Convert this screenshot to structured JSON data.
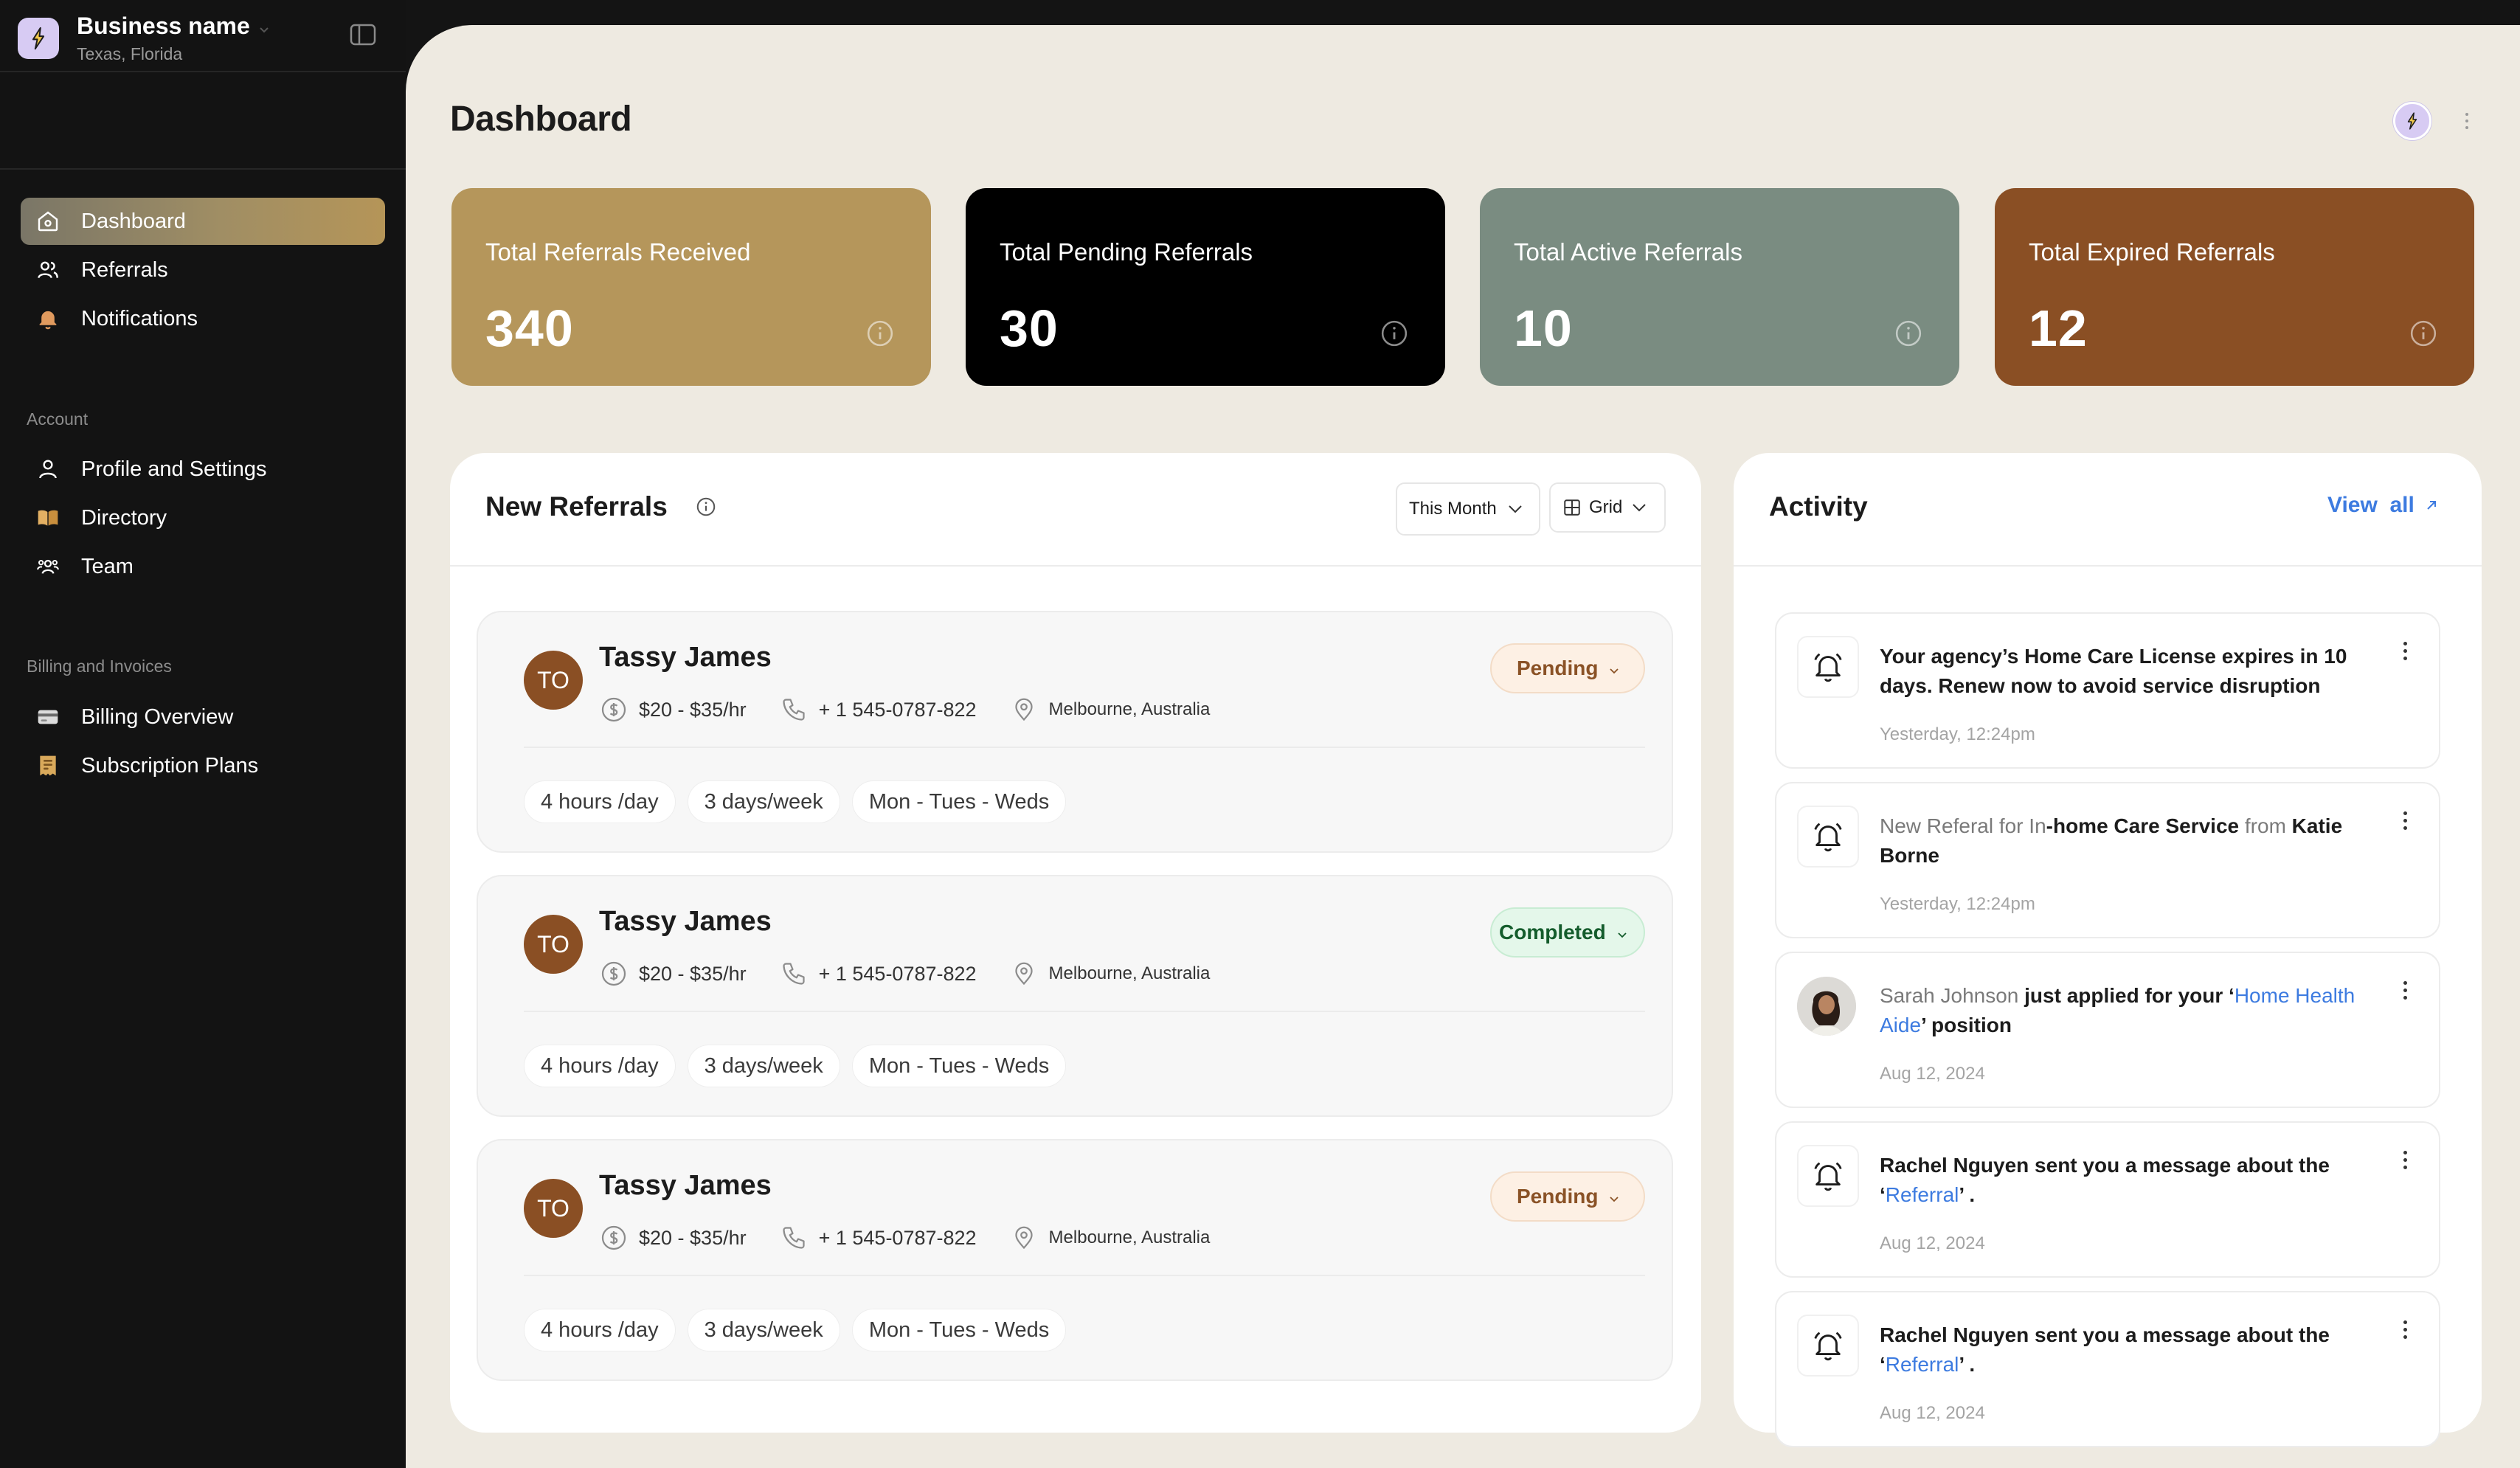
{
  "business": {
    "name": "Business name",
    "location": "Texas, Florida"
  },
  "sidebar": {
    "main_items": [
      {
        "label": "Dashboard",
        "icon": "home-icon",
        "active": true
      },
      {
        "label": "Referrals",
        "icon": "users-icon"
      },
      {
        "label": "Notifications",
        "icon": "bell-icon"
      }
    ],
    "account_section": "Account",
    "account_items": [
      {
        "label": "Profile and Settings",
        "icon": "user-icon"
      },
      {
        "label": "Directory",
        "icon": "book-icon"
      },
      {
        "label": "Team",
        "icon": "team-icon"
      }
    ],
    "billing_section": "Billing and Invoices",
    "billing_items": [
      {
        "label": "Billing Overview",
        "icon": "card-icon"
      },
      {
        "label": "Subscription Plans",
        "icon": "receipt-icon"
      }
    ]
  },
  "header": {
    "title": "Dashboard"
  },
  "stats": [
    {
      "label": "Total Referrals Received",
      "value": "340",
      "color": "#b5965b"
    },
    {
      "label": "Total Pending Referrals",
      "value": "30",
      "color": "#000000"
    },
    {
      "label": "Total Active Referrals",
      "value": "10",
      "color": "#7a8c81"
    },
    {
      "label": "Total Expired Referrals",
      "value": "12",
      "color": "#8a4f24"
    }
  ],
  "new_referrals": {
    "title": "New Referrals",
    "filter_label": "This Month",
    "view_label": "Grid",
    "cards": [
      {
        "initials": "TO",
        "name": "Tassy James",
        "rate": "$20 - $35/hr",
        "phone": "+ 1 545-0787-822",
        "location": "Melbourne, Australia",
        "status": "Pending",
        "tags": [
          "4 hours /day",
          "3 days/week",
          "Mon - Tues - Weds"
        ]
      },
      {
        "initials": "TO",
        "name": "Tassy James",
        "rate": "$20 - $35/hr",
        "phone": "+ 1 545-0787-822",
        "location": "Melbourne, Australia",
        "status": "Completed",
        "tags": [
          "4 hours /day",
          "3 days/week",
          "Mon - Tues - Weds"
        ]
      },
      {
        "initials": "TO",
        "name": "Tassy James",
        "rate": "$20 - $35/hr",
        "phone": "+ 1 545-0787-822",
        "location": "Melbourne, Australia",
        "status": "Pending",
        "tags": [
          "4 hours /day",
          "3 days/week",
          "Mon - Tues - Weds"
        ]
      }
    ]
  },
  "activity": {
    "title": "Activity",
    "view_all": "View  all",
    "items": [
      {
        "line": "Your agency’s Home Care License expires in 10 days. Renew now to avoid service disruption",
        "time": "Yesterday, 12:24pm"
      },
      {
        "p1": "New Referal for In",
        "p2": "-home Care Service",
        "p3": " from ",
        "p4": "Katie Borne",
        "time": "Yesterday, 12:24pm"
      },
      {
        "p1": "Sarah Johnson",
        "p2": " just applied for your ‘",
        "p3": "Home Health Aide",
        "p4": "’ position",
        "time": "Aug 12, 2024"
      },
      {
        "p1": "Rachel Nguyen sent you a message about the ‘",
        "p2": "Referral",
        "p3": "’ .",
        "time": "Aug 12, 2024"
      },
      {
        "p1": "Rachel Nguyen sent you a message about the ‘",
        "p2": "Referral",
        "p3": "’ .",
        "time": "Aug 12, 2024"
      }
    ]
  }
}
